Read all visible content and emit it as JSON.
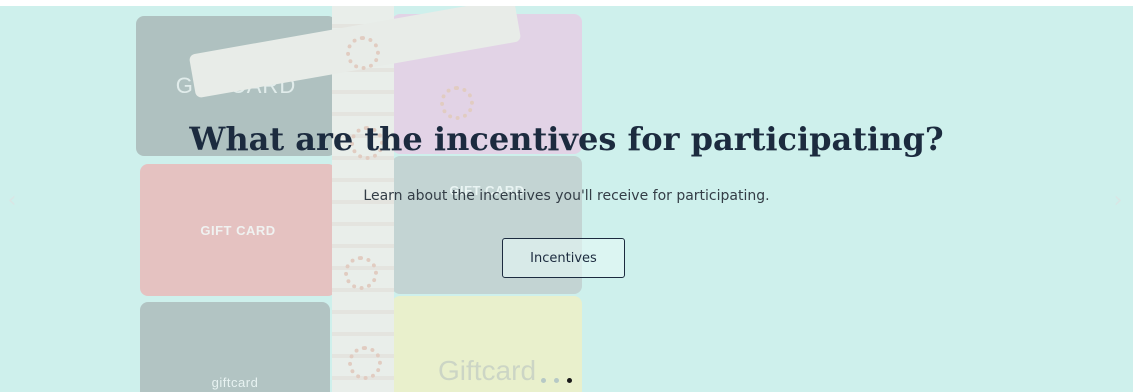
{
  "slide": {
    "heading": "What are the incentives for participating?",
    "description": "Learn about the incentives you'll receive for participating.",
    "button_label": "Incentives"
  },
  "background_cards": [
    {
      "label": "GIFTCARD"
    },
    {
      "label": "GIFT CARD"
    },
    {
      "label": "GIFT CARD"
    },
    {
      "label": "giftcard"
    },
    {
      "label": "Giftcard"
    }
  ],
  "carousel": {
    "prev_icon": "chevron-left-icon",
    "next_icon": "chevron-right-icon",
    "indicator_count": 3,
    "active_indicator": 3
  },
  "colors": {
    "background": "#c9eeea",
    "heading": "#1c2b3f",
    "text": "#333d46"
  }
}
